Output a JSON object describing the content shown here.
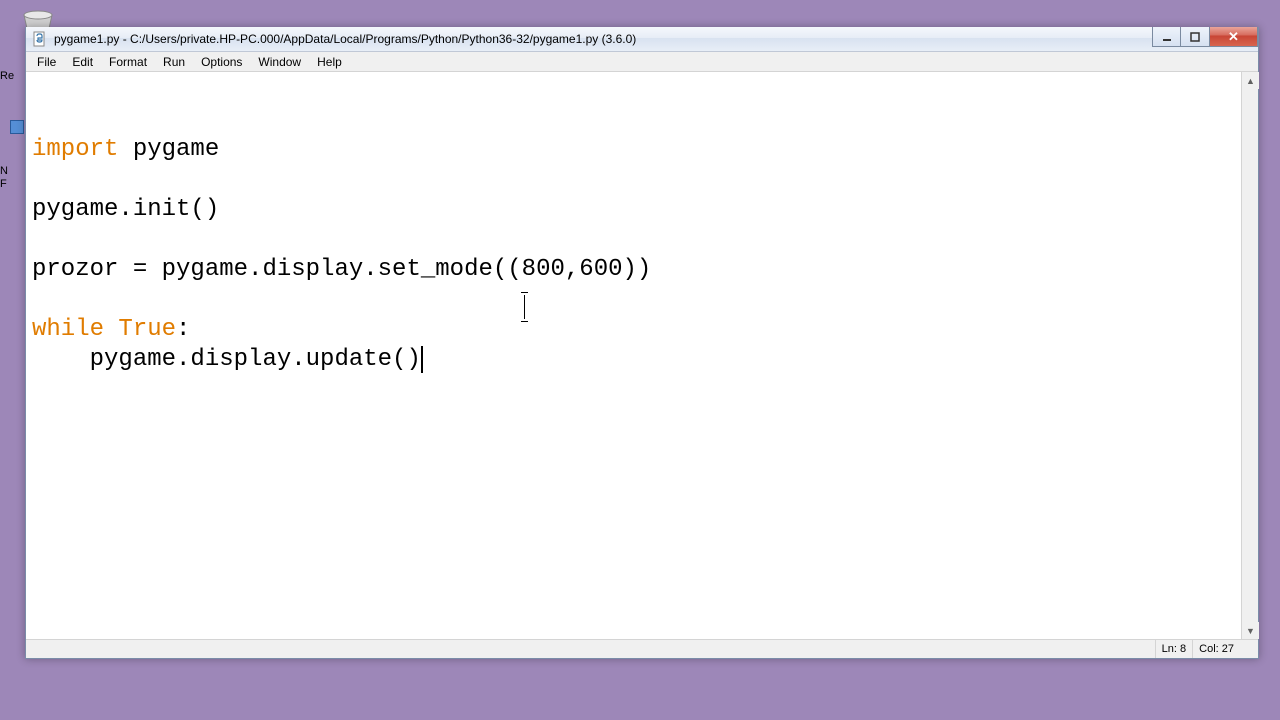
{
  "desktop": {
    "icon1_label": "Re",
    "icon2_label_line1": "N",
    "icon2_label_line2": "F"
  },
  "window": {
    "title": "pygame1.py - C:/Users/private.HP-PC.000/AppData/Local/Programs/Python/Python36-32/pygame1.py (3.6.0)"
  },
  "menubar": {
    "items": [
      "File",
      "Edit",
      "Format",
      "Run",
      "Options",
      "Window",
      "Help"
    ]
  },
  "code": {
    "lines": [
      {
        "type": "keyword-line",
        "kw": "import",
        "rest": " pygame"
      },
      {
        "type": "blank"
      },
      {
        "type": "plain",
        "text": "pygame.init()"
      },
      {
        "type": "blank"
      },
      {
        "type": "plain",
        "text": "prozor = pygame.display.set_mode((800,600))"
      },
      {
        "type": "blank"
      },
      {
        "type": "while-line",
        "kw1": "while",
        "sp": " ",
        "kw2": "True",
        "rest": ":"
      },
      {
        "type": "plain",
        "text": "    pygame.display.update()",
        "has_cursor": true
      }
    ]
  },
  "statusbar": {
    "line_label": "Ln: 8",
    "col_label": "Col: 27"
  }
}
